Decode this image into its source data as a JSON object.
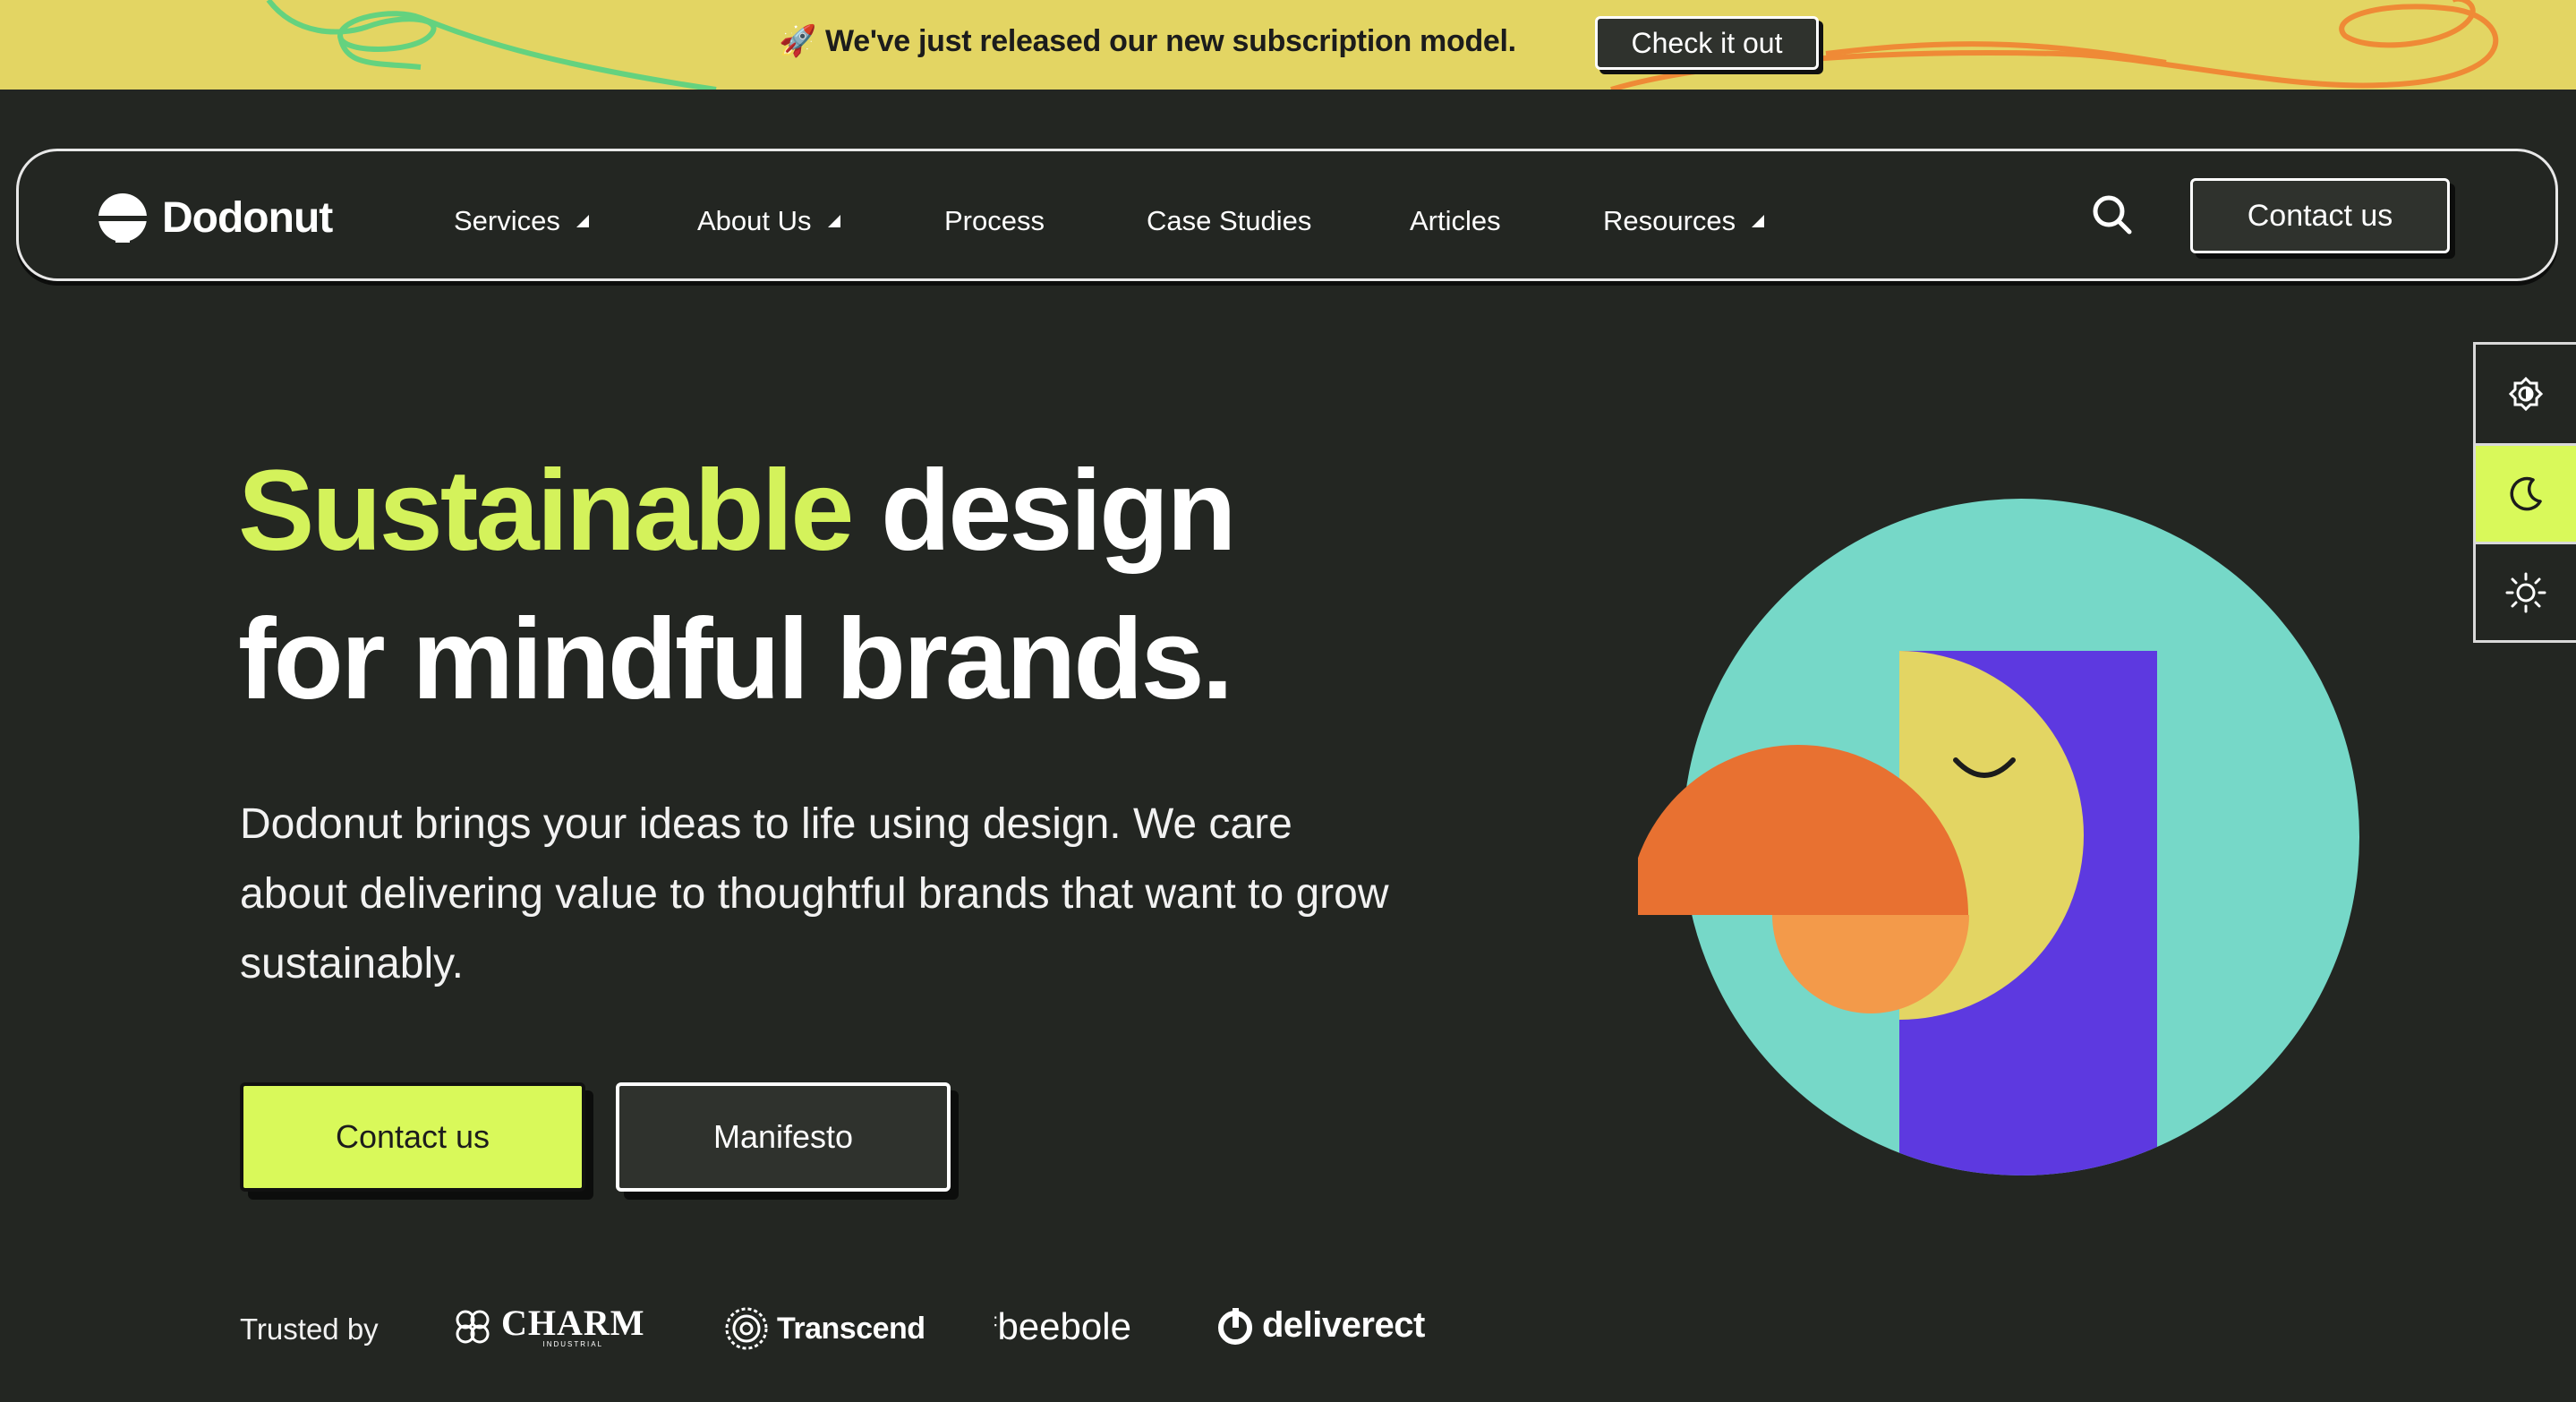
{
  "announcement": {
    "icon": "rocket-icon",
    "emoji": "🚀",
    "message": "We've just released our new subscription model.",
    "cta_label": "Check it out"
  },
  "nav": {
    "brand": "Dodonut",
    "items": [
      {
        "label": "Services",
        "has_dropdown": true
      },
      {
        "label": "About Us",
        "has_dropdown": true
      },
      {
        "label": "Process",
        "has_dropdown": false
      },
      {
        "label": "Case Studies",
        "has_dropdown": false
      },
      {
        "label": "Articles",
        "has_dropdown": false
      },
      {
        "label": "Resources",
        "has_dropdown": true
      }
    ],
    "search_icon": "search-icon",
    "contact_label": "Contact us"
  },
  "theme_toggle": {
    "options": [
      "contrast-icon",
      "moon-icon",
      "sun-icon"
    ],
    "active": "moon-icon"
  },
  "hero": {
    "title_accent": "Sustainable",
    "title_rest_line1": " design",
    "title_line2": "for mindful brands.",
    "description": "Dodonut brings your ideas to life using design. We care about delivering value to thoughtful brands that want to grow sustainably.",
    "primary_cta": "Contact us",
    "secondary_cta": "Manifesto"
  },
  "trusted": {
    "label": "Trusted by",
    "clients": [
      "CHARM",
      "Transcend",
      "beebole",
      "deliverect"
    ],
    "charm_sub": "INDUSTRIAL"
  },
  "colors": {
    "background": "#232622",
    "accent": "#d9f95a",
    "announcement_bg": "#e3d563",
    "illustration_teal": "#76d8c8",
    "illustration_purple": "#5d39e0",
    "illustration_yellow": "#e3d563",
    "illustration_orange": "#e87131",
    "illustration_light_orange": "#f39a4a"
  }
}
